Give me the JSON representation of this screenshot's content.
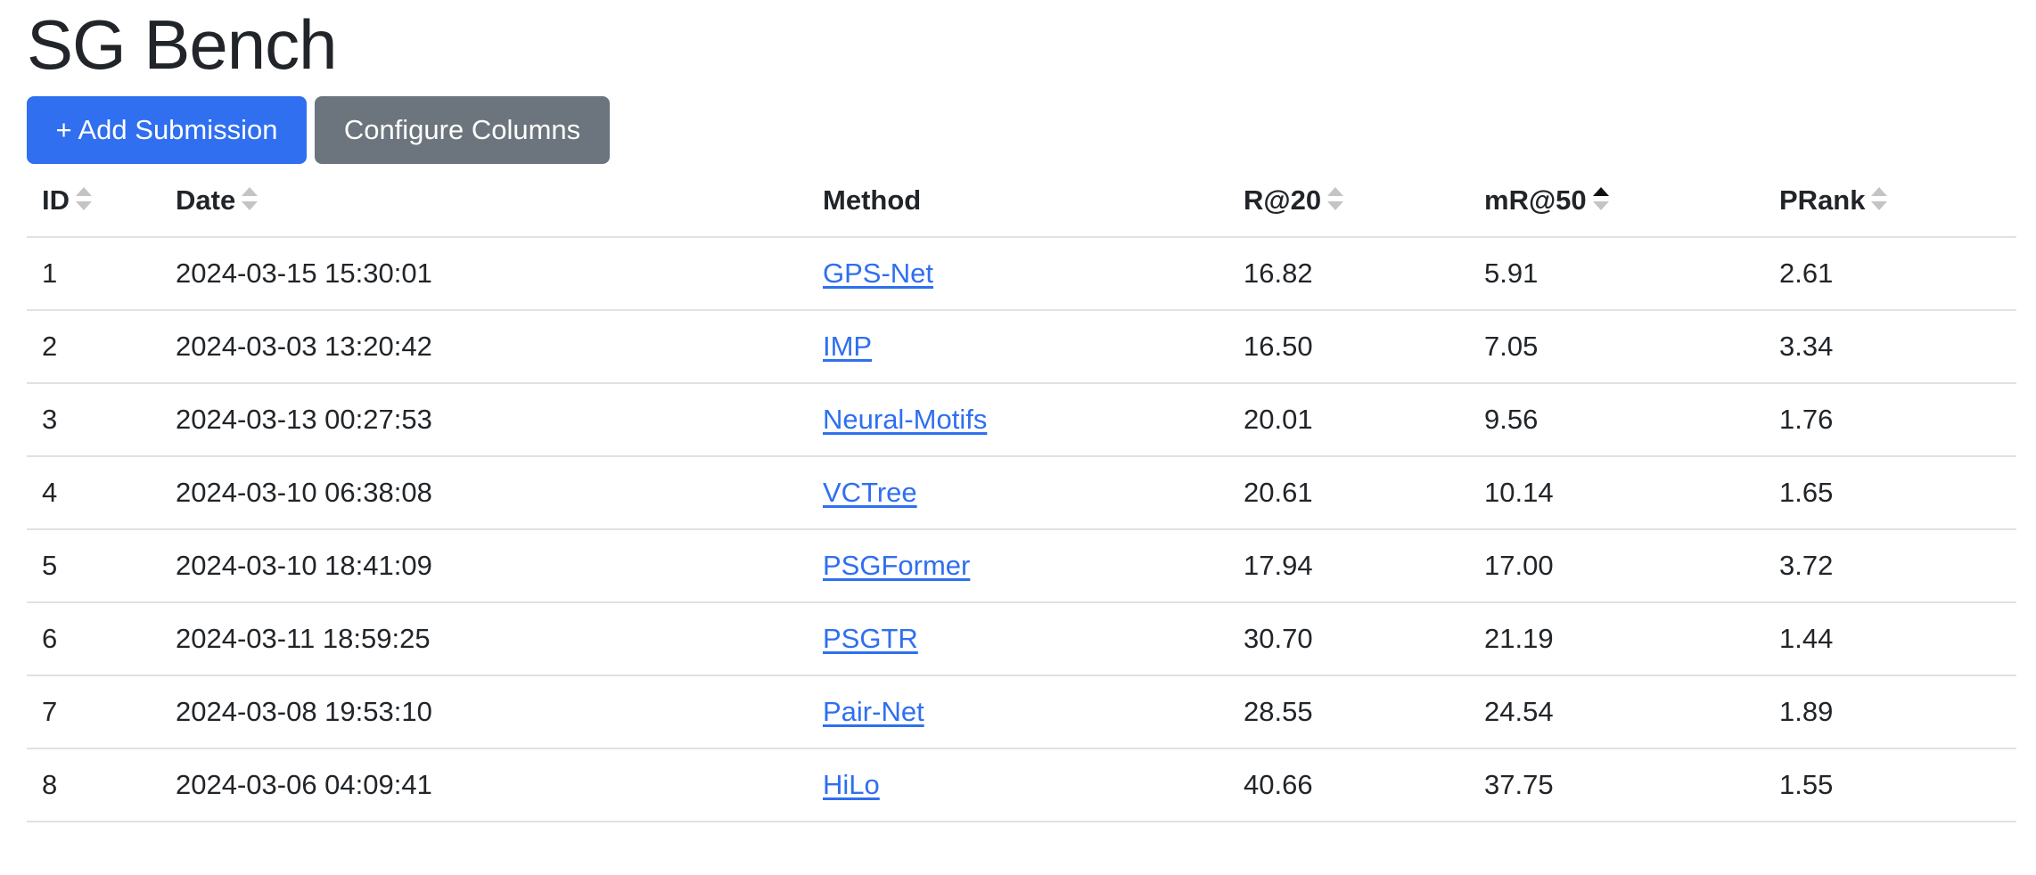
{
  "page": {
    "title": "SG Bench"
  },
  "toolbar": {
    "add_label": "+ Add Submission",
    "configure_label": "Configure Columns"
  },
  "table": {
    "headers": {
      "id": "ID",
      "date": "Date",
      "method": "Method",
      "r20": "R@20",
      "mr50": "mR@50",
      "prank": "PRank"
    },
    "sort": {
      "column": "mR@50",
      "direction": "ascending"
    },
    "rows": [
      {
        "id": "1",
        "date": "2024-03-15 15:30:01",
        "method": "GPS-Net",
        "r20": "16.82",
        "mr50": "5.91",
        "prank": "2.61"
      },
      {
        "id": "2",
        "date": "2024-03-03 13:20:42",
        "method": "IMP",
        "r20": "16.50",
        "mr50": "7.05",
        "prank": "3.34"
      },
      {
        "id": "3",
        "date": "2024-03-13 00:27:53",
        "method": "Neural-Motifs",
        "r20": "20.01",
        "mr50": "9.56",
        "prank": "1.76"
      },
      {
        "id": "4",
        "date": "2024-03-10 06:38:08",
        "method": "VCTree",
        "r20": "20.61",
        "mr50": "10.14",
        "prank": "1.65"
      },
      {
        "id": "5",
        "date": "2024-03-10 18:41:09",
        "method": "PSGFormer",
        "r20": "17.94",
        "mr50": "17.00",
        "prank": "3.72"
      },
      {
        "id": "6",
        "date": "2024-03-11 18:59:25",
        "method": "PSGTR",
        "r20": "30.70",
        "mr50": "21.19",
        "prank": "1.44"
      },
      {
        "id": "7",
        "date": "2024-03-08 19:53:10",
        "method": "Pair-Net",
        "r20": "28.55",
        "mr50": "24.54",
        "prank": "1.89"
      },
      {
        "id": "8",
        "date": "2024-03-06 04:09:41",
        "method": "HiLo",
        "r20": "40.66",
        "mr50": "37.75",
        "prank": "1.55"
      }
    ]
  },
  "colors": {
    "primary": "#2f6ff0",
    "secondary": "#6c757d",
    "sort_inactive": "#c4c4c4",
    "sort_active": "#111111"
  }
}
